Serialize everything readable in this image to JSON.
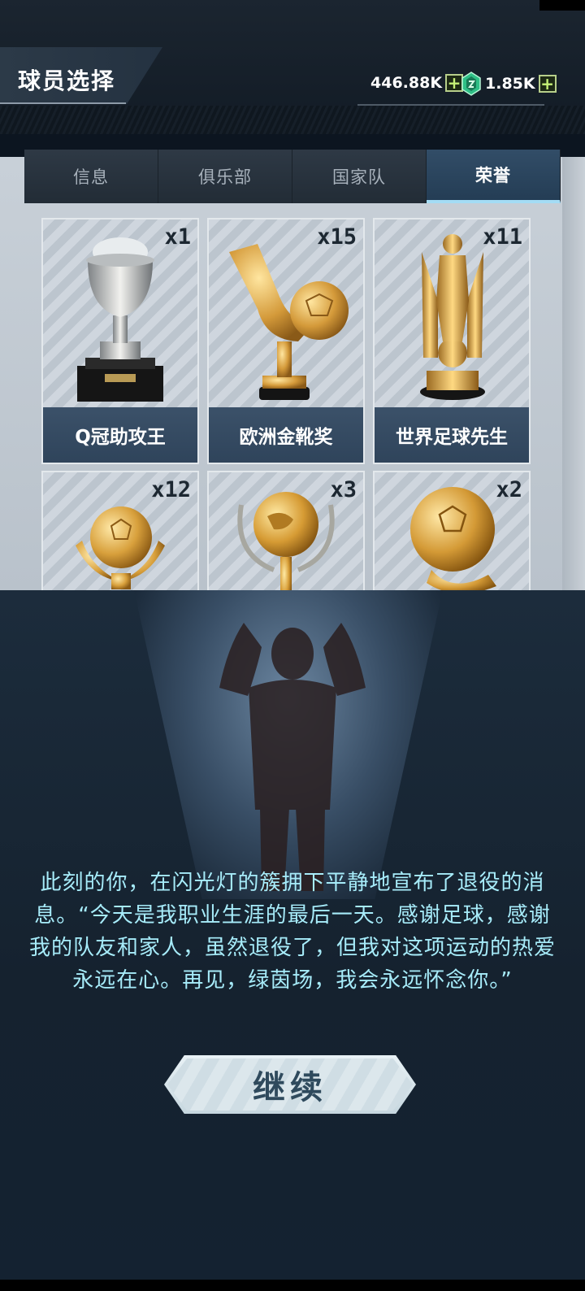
{
  "header": {
    "title": "球员选择",
    "currencies": [
      {
        "value": "446.88K",
        "icon": "coin-icon"
      },
      {
        "value": "1.85K",
        "icon": "green-gem-icon"
      }
    ]
  },
  "tabs": [
    {
      "label": "信息",
      "active": false
    },
    {
      "label": "俱乐部",
      "active": false
    },
    {
      "label": "国家队",
      "active": false
    },
    {
      "label": "荣誉",
      "active": true
    }
  ],
  "honors": [
    {
      "name": "Q冠助攻王",
      "count": "x1",
      "icon": "silver-cup-trophy-icon"
    },
    {
      "name": "欧洲金靴奖",
      "count": "x15",
      "icon": "golden-boot-trophy-icon"
    },
    {
      "name": "世界足球先生",
      "count": "x11",
      "icon": "golden-player-statue-icon"
    },
    {
      "name": "",
      "count": "x12",
      "icon": "winged-golden-ball-icon"
    },
    {
      "name": "",
      "count": "x3",
      "icon": "laurel-globe-trophy-icon"
    },
    {
      "name": "",
      "count": "x2",
      "icon": "golden-ball-trophy-icon"
    }
  ],
  "story": {
    "text": "此刻的你，在闪光灯的簇拥下平静地宣布了退役的消息。“今天是我职业生涯的最后一天。感谢足球，感谢我的队友和家人，虽然退役了，但我对这项运动的热爱永远在心。再见，绿茵场，我会永远怀念你。”"
  },
  "buttons": {
    "continue_label": "继续"
  },
  "colors": {
    "accent_tab": "#a4dcf5",
    "story_text": "#a7ecfa",
    "label_bg": "#3b5169",
    "plus_green": "#c6f277"
  }
}
